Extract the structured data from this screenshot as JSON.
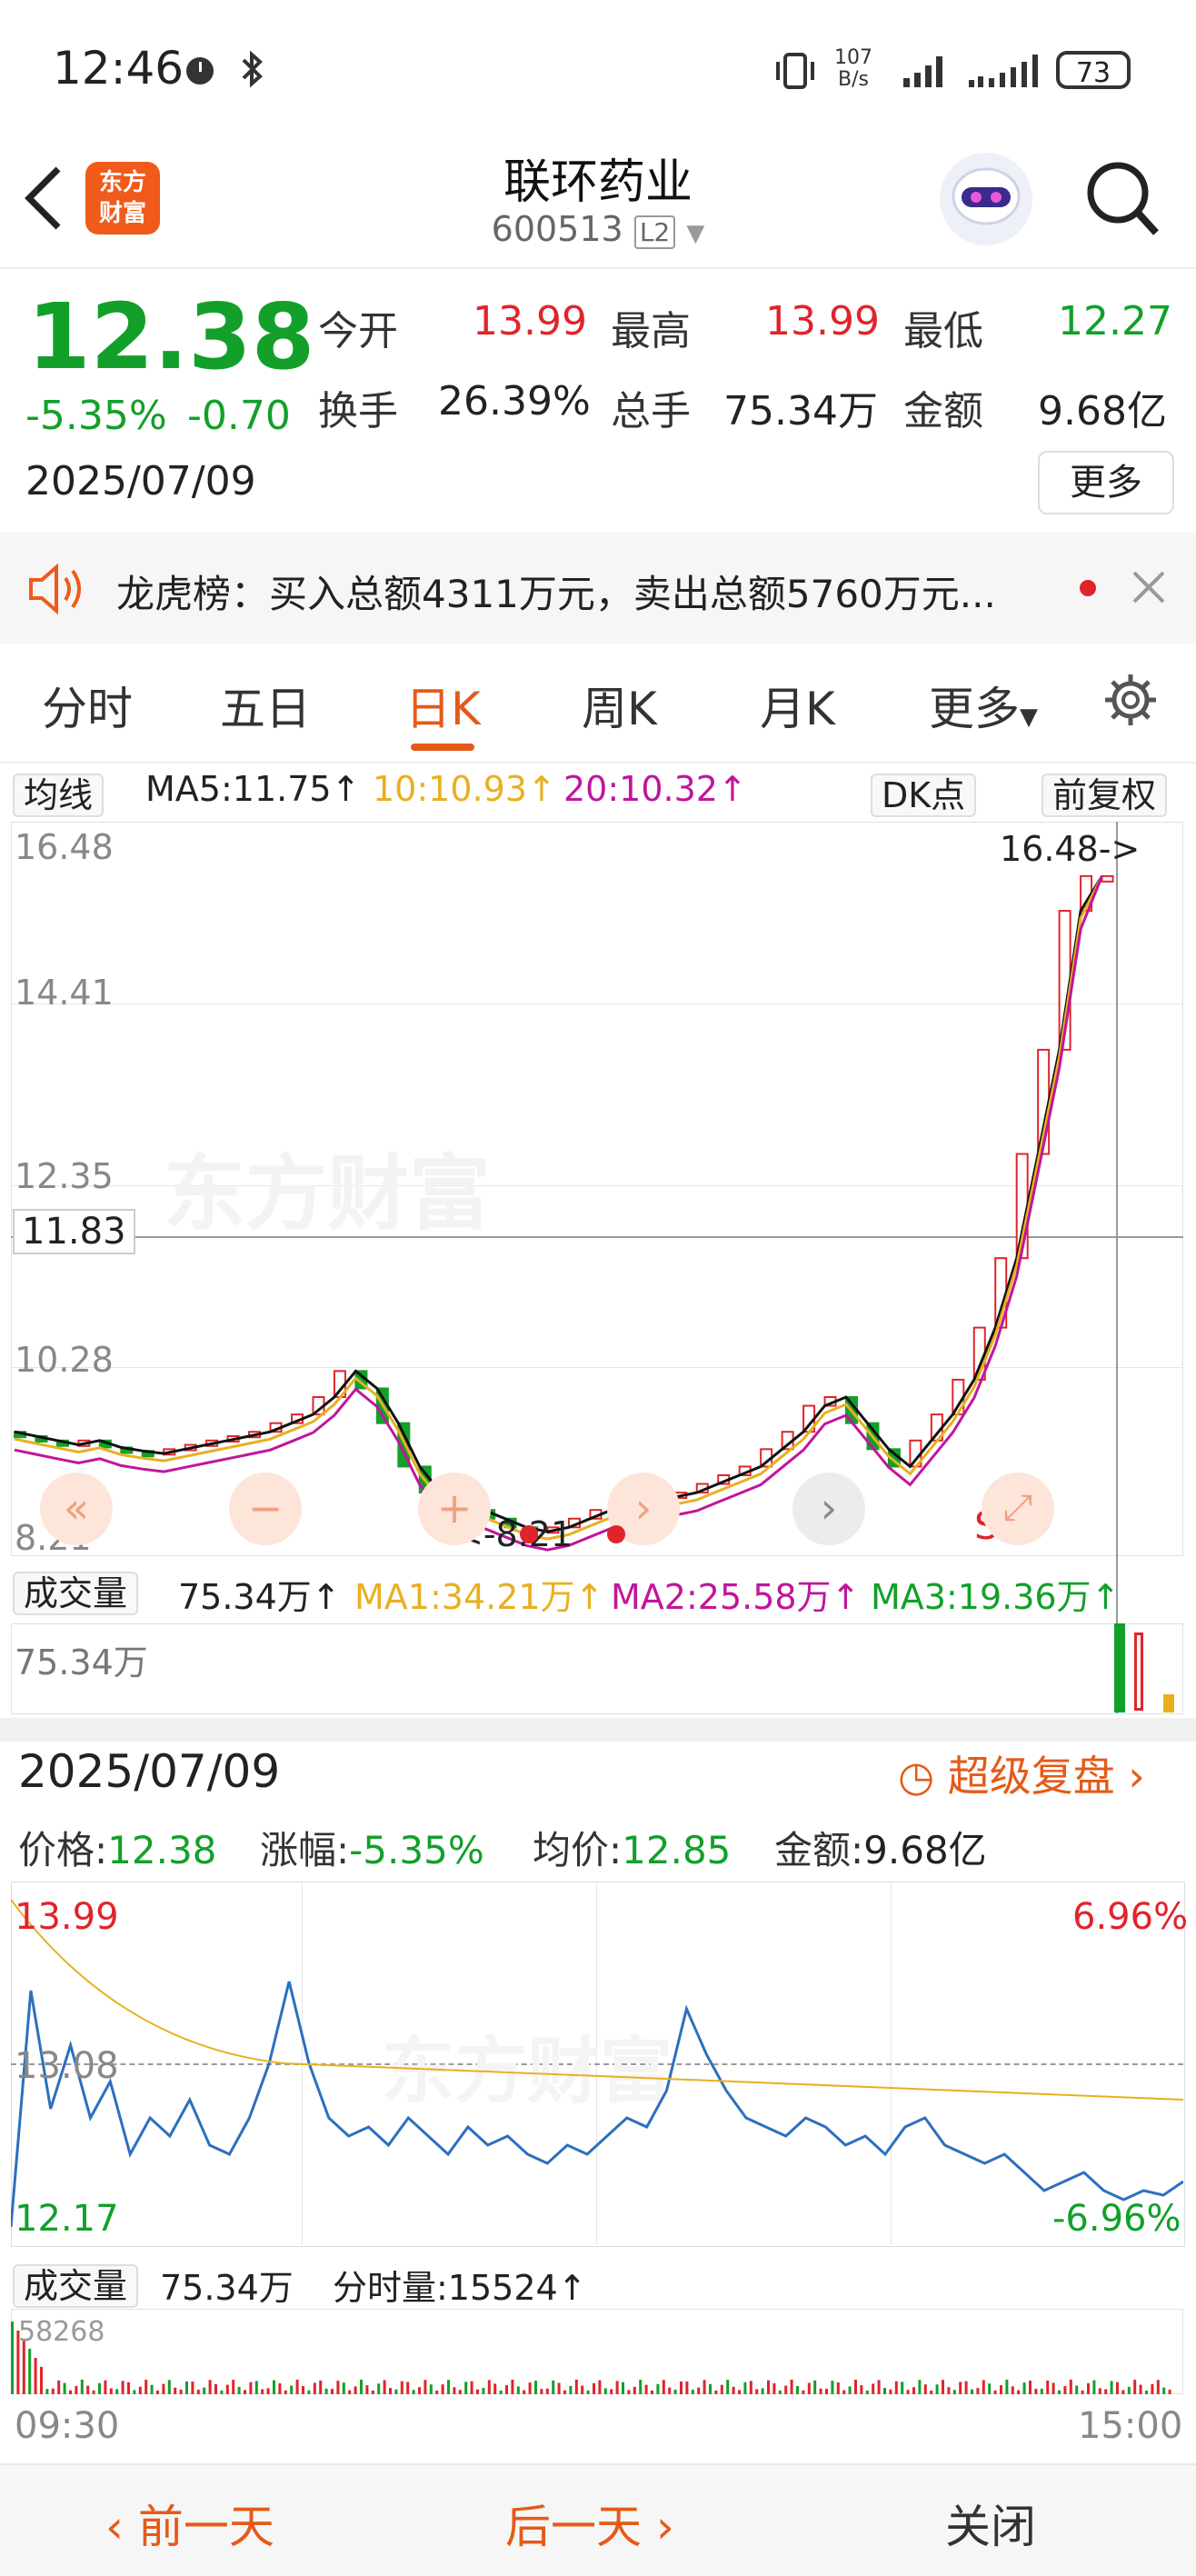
{
  "status": {
    "time": "12:46",
    "net_speed": "107\nB/s",
    "battery": "73"
  },
  "header": {
    "back_label": "<",
    "logo_text": "东方\n财富",
    "title": "联环药业",
    "code": "600513",
    "level": "L2"
  },
  "quote": {
    "price": "12.38",
    "change_pct": "-5.35%",
    "change": "-0.70",
    "date": "2025/07/09",
    "fields": [
      {
        "label": "今开",
        "value": "13.99"
      },
      {
        "label": "最高",
        "value": "13.99"
      },
      {
        "label": "最低",
        "value": "12.27"
      },
      {
        "label": "换手",
        "value": "26.39%"
      },
      {
        "label": "总手",
        "value": "75.34万"
      },
      {
        "label": "金额",
        "value": "9.68亿"
      }
    ],
    "more_label": "更多"
  },
  "notice": {
    "text": "龙虎榜：买入总额4311万元，卖出总额5760万元..."
  },
  "tabs": [
    "分时",
    "五日",
    "日K",
    "周K",
    "月K",
    "更多"
  ],
  "kline": {
    "ma_selector": "均线",
    "ma5": "MA5:11.75↑",
    "ma10": "10:10.93↑",
    "ma20": "20:10.32↑",
    "dk_label": "DK点",
    "adjust_label": "前复权",
    "y_labels": [
      "16.48",
      "14.41",
      "12.35",
      "10.28",
      "8.21"
    ],
    "crosshair_value": "11.83",
    "max_marker": "16.48->",
    "min_marker": "<-8.21",
    "signal_s": "S",
    "colors": {
      "ma5": "#111111",
      "ma10": "#e8b020",
      "ma20": "#c0169b",
      "up": "#e0242b",
      "down": "#12a02a"
    }
  },
  "volume": {
    "selector": "成交量",
    "total": "75.34万↑",
    "ma1": "MA1:34.21万↑",
    "ma2": "MA2:25.58万↑",
    "ma3": "MA3:19.36万↑",
    "axis_label": "75.34万"
  },
  "detail": {
    "date": "2025/07/09",
    "replay_label": "超级复盘",
    "price_label": "价格:",
    "price": "12.38",
    "pct_label": "涨幅:",
    "pct": "-5.35%",
    "avg_label": "均价:",
    "avg": "12.85",
    "amount_label": "金额:",
    "amount": "9.68亿",
    "y_top": "13.99",
    "y_mid": "13.08",
    "y_bot": "12.17",
    "pct_top": "6.96%",
    "pct_bot": "-6.96%",
    "vol_selector": "成交量",
    "vol_total": "75.34万",
    "vol_tick": "分时量:15524↑",
    "vol_axis": "58268",
    "time_start": "09:30",
    "time_end": "15:00"
  },
  "footer": {
    "prev": "前一天",
    "next": "后一天",
    "close": "关闭"
  }
}
